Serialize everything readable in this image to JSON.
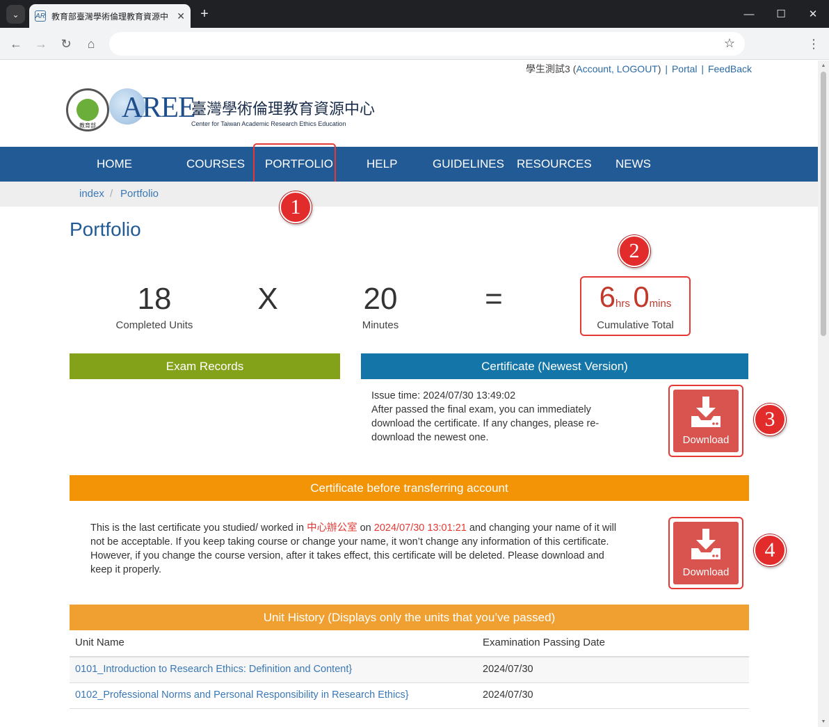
{
  "browser": {
    "tab_title": "教育部臺灣學術倫理教育資源中",
    "tab_favicon": "AR",
    "tab_close": "✕",
    "new_tab": "+",
    "tab_menu": "⌄",
    "win_minimize": "—",
    "win_maximize": "☐",
    "win_close": "✕",
    "back": "←",
    "forward": "→",
    "reload": "↻",
    "home": "⌂",
    "bookmark": "☆",
    "menu": "⋮",
    "address": ""
  },
  "userbar": {
    "username": "學生測試3 (",
    "account": "Account",
    "comma": ", ",
    "logout": "LOGOUT",
    "close_paren": ")",
    "sep1": "|",
    "portal": "Portal",
    "sep2": "|",
    "feedback": "FeedBack"
  },
  "logo": {
    "aree": "AREE",
    "chinese": "臺灣學術倫理教育資源中心",
    "english": "Center for Taiwan Academic Research Ethics Education",
    "seal_text": "教育部"
  },
  "nav": {
    "items": [
      "HOME",
      "COURSES",
      "PORTFOLIO",
      "HELP",
      "GUIDELINES",
      "RESOURCES",
      "NEWS"
    ]
  },
  "breadcrumb": {
    "items": [
      "index",
      "Portfolio"
    ],
    "separator": "/"
  },
  "page_title": "Portfolio",
  "stats": {
    "units_value": "18",
    "units_label": "Completed Units",
    "times": "X",
    "minutes_value": "20",
    "minutes_label": "Minutes",
    "equals": "=",
    "hours": "6",
    "hours_unit": "hrs",
    "mins": "0",
    "mins_unit": "mins",
    "total_label": "Cumulative Total"
  },
  "exam_records": {
    "title": "Exam Records",
    "color": "#84a11a"
  },
  "certificate": {
    "title": "Certificate (Newest Version)",
    "color": "#1475a8",
    "issue_time": "Issue time: 2024/07/30 13:49:02",
    "description": "After passed the final exam, you can immediately download the certificate. If any changes, please re-download the newest one.",
    "download_label": "Download"
  },
  "transfer": {
    "title": "Certificate before transferring account",
    "color": "#f39406",
    "text_before": "This is the last certificate you studied/ worked in ",
    "office": "中心辦公室",
    "text_on": " on ",
    "date": "2024/07/30 13:01:21",
    "text_after": " and changing your name of it will not be acceptable. If you keep taking course or change your name, it won’t change any information of this certificate. However, if you change the course version, after it takes effect, this certificate will be deleted. Please download and keep it properly.",
    "download_label": "Download"
  },
  "unit_history": {
    "title": "Unit History (Displays only the units that you’ve passed)",
    "color": "#f0a030",
    "columns": [
      "Unit Name",
      "Examination Passing Date"
    ],
    "rows": [
      {
        "name": "0101_Introduction to Research Ethics: Definition and Content}",
        "date": "2024/07/30"
      },
      {
        "name": "0102_Professional Norms and Personal Responsibility in Research Ethics}",
        "date": "2024/07/30"
      }
    ]
  },
  "annotations": {
    "markers": [
      "1",
      "2",
      "3",
      "4"
    ],
    "marker_color": "#e22b2b"
  }
}
